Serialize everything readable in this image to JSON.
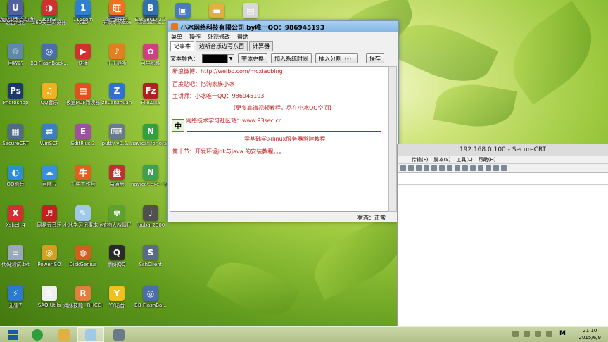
{
  "desktop": {
    "icons": [
      {
        "label": "这台电脑",
        "glyph": "▣",
        "color": "#3a7fd0"
      },
      {
        "label": "360安全浏览器",
        "glyph": "e",
        "color": "#2e9d3a"
      },
      {
        "label": "X3D",
        "glyph": "X",
        "color": "#2a70c0"
      },
      {
        "label": "屏录专家exe",
        "glyph": "◉",
        "color": "#5060a0"
      },
      {
        "label": "PacketTra...",
        "glyph": "P",
        "color": "#40607a"
      },
      {
        "label": "回收站",
        "glyph": "♲",
        "color": "#5c8aa8"
      },
      {
        "label": "BB FlashBack...",
        "glyph": "◎",
        "color": "#4a6ea8"
      },
      {
        "label": "快播",
        "glyph": "▶",
        "color": "#d03030"
      },
      {
        "label": "千千静听",
        "glyph": "♪",
        "color": "#e08020"
      },
      {
        "label": "可牛影像",
        "glyph": "✿",
        "color": "#d04080"
      },
      {
        "label": "Photoshop",
        "glyph": "Ps",
        "color": "#1a3a6a"
      },
      {
        "label": "QQ音乐",
        "glyph": "♫",
        "color": "#f0b020"
      },
      {
        "label": "极速PDF阅读器",
        "glyph": "▤",
        "color": "#e05020"
      },
      {
        "label": "zhuanzhuan",
        "glyph": "Z",
        "color": "#3070d0"
      },
      {
        "label": "FileZilla",
        "glyph": "Fz",
        "color": "#b02020"
      },
      {
        "label": "SecureCRT",
        "glyph": "▦",
        "color": "#506a8a"
      },
      {
        "label": "WinSCP",
        "glyph": "⇄",
        "color": "#3a80c0"
      },
      {
        "label": "EditPlus 3",
        "glyph": "E",
        "color": "#a050a0"
      },
      {
        "label": "putty v0.6...",
        "glyph": "⌨",
        "color": "#6a7a8a"
      },
      {
        "label": "navicat for oracle",
        "glyph": "N",
        "color": "#30a040"
      },
      {
        "label": "QQ影音",
        "glyph": "◐",
        "color": "#2a90d0"
      },
      {
        "label": "百度云",
        "glyph": "☁",
        "color": "#3a8ee0"
      },
      {
        "label": "千牛工作台",
        "glyph": "牛",
        "color": "#e06020"
      },
      {
        "label": "易通盘",
        "glyph": "盘",
        "color": "#c03030"
      },
      {
        "label": "navicat.exe - 快捷方式",
        "glyph": "N",
        "color": "#40a050"
      },
      {
        "label": "Xshell 4",
        "glyph": "X",
        "color": "#d03030"
      },
      {
        "label": "网易云音乐",
        "glyph": "♬",
        "color": "#c02020"
      },
      {
        "label": "小冰学习记事本 v1.2...",
        "glyph": "✎",
        "color": "#a0c8e8"
      },
      {
        "label": "植物大战僵尸",
        "glyph": "✾",
        "color": "#60a030"
      },
      {
        "label": "foobar2000",
        "glyph": "♩",
        "color": "#505050"
      },
      {
        "label": "代码测试.txt",
        "glyph": "≡",
        "color": "#9aa8b8"
      },
      {
        "label": "PowerISO",
        "glyph": "◎",
        "color": "#d0a020"
      },
      {
        "label": "DiskGenius",
        "glyph": "◍",
        "color": "#d06020"
      },
      {
        "label": "腾讯QQ",
        "glyph": "Q",
        "color": "#2a2a2a"
      },
      {
        "label": "SshClient",
        "glyph": "S",
        "color": "#5a6a8a"
      },
      {
        "label": "迅雷7",
        "glyph": "⚡",
        "color": "#2a7ad0"
      },
      {
        "label": "SAO Utils",
        "glyph": "S",
        "color": "#f0f0f0"
      },
      {
        "label": "海豚技能 _RHCE-EX...",
        "glyph": "R",
        "color": "#e08040"
      },
      {
        "label": "YY语音",
        "glyph": "Y",
        "color": "#f0c020"
      },
      {
        "label": "BB FlashBa...",
        "glyph": "◎",
        "color": "#4a6ea8"
      },
      {
        "label": "反恐精英 CS1.6",
        "glyph": "CS",
        "color": "#4a4a4a"
      },
      {
        "label": "ican3",
        "glyph": "◑",
        "color": "#d03030"
      },
      {
        "label": "115com",
        "glyph": "1",
        "color": "#3080d0"
      },
      {
        "label": "淘宝旺旺4",
        "glyph": "旺",
        "color": "#f07020"
      },
      {
        "label": "EasyBCD 2.3",
        "glyph": "B",
        "color": "#3070b0"
      },
      {
        "label": "电脑店U盘启动盘制作工...",
        "glyph": "U",
        "color": "#5060a0"
      },
      {
        "label": "",
        "glyph": "▣",
        "color": "#4a7ac0"
      },
      {
        "label": "",
        "glyph": "▬",
        "color": "#e0b040"
      },
      {
        "label": "",
        "glyph": "▤",
        "color": "#d8d8d8"
      }
    ]
  },
  "notepad": {
    "title": "小冰网络科技有限公司 by唯一QQ：986945193",
    "menu": [
      "菜单",
      "操作",
      "外观修改",
      "帮助"
    ],
    "tabs": [
      "记事本",
      "边听音乐边写东西",
      "计算器"
    ],
    "toolbar": {
      "color_label": "文本颜色：",
      "font_button": "字体更换",
      "add_time_button": "加入系统时间",
      "insert_divider_button": "插入分割（-）",
      "save_button": "保存"
    },
    "content_lines": [
      "新浪微博：http://weibo.com/mcxiaobing",
      "百度贴吧：忆驹家族小冰",
      "主讲师：小冰唯一QQ：986945193",
      "【更多高清视频教程，尽在小冰QQ空间】",
      "网络技术学习社区站：www.93sec.cc",
      "零基础学习linux服务器搭建教程",
      "第十节：开发环境jdk与java 的安装教程。。。"
    ],
    "ime_label": "中",
    "status": "状态：正常",
    "text_color": "#c02020"
  },
  "securecrt": {
    "title": "192.168.0.100 - SecureCRT",
    "menu": [
      "传输(F)",
      "脚本(S)",
      "工具(L)",
      "帮助(H)"
    ]
  },
  "taskbar": {
    "time": "21:10",
    "date": "2015/6/9",
    "ime_indicator": "M"
  }
}
